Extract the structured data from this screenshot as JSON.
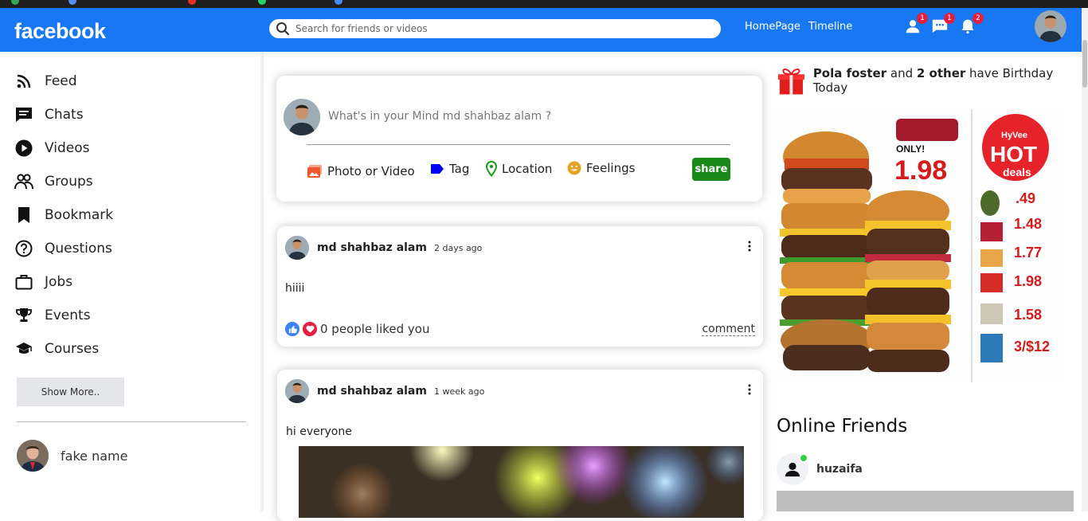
{
  "header": {
    "logo": "facebook",
    "search_placeholder": "Search for friends or videos",
    "links": [
      "HomePage",
      "Timeline"
    ],
    "notifications": [
      {
        "icon": "person-icon",
        "count": "1"
      },
      {
        "icon": "chat-icon",
        "count": "1"
      },
      {
        "icon": "bell-icon",
        "count": "2"
      }
    ]
  },
  "sidebar": {
    "items": [
      {
        "label": "Feed",
        "icon": "rss-icon"
      },
      {
        "label": "Chats",
        "icon": "chat-icon"
      },
      {
        "label": "Videos",
        "icon": "play-circle-icon"
      },
      {
        "label": "Groups",
        "icon": "group-icon"
      },
      {
        "label": "Bookmark",
        "icon": "bookmark-icon"
      },
      {
        "label": "Questions",
        "icon": "help-circle-icon"
      },
      {
        "label": "Jobs",
        "icon": "briefcase-icon"
      },
      {
        "label": "Events",
        "icon": "trophy-icon"
      },
      {
        "label": "Courses",
        "icon": "graduation-cap-icon"
      }
    ],
    "show_more": "Show More..",
    "friends": [
      {
        "name": "fake name"
      }
    ]
  },
  "share": {
    "prompt": "What's in your Mind md shahbaz alam ?",
    "options": [
      {
        "label": "Photo or Video",
        "icon": "photo-icon",
        "color": "#f3582c"
      },
      {
        "label": "Tag",
        "icon": "tag-icon",
        "color": "#0000ff"
      },
      {
        "label": "Location",
        "icon": "location-pin-icon",
        "color": "#1a9d1a"
      },
      {
        "label": "Feelings",
        "icon": "smiley-icon",
        "color": "#e3a325"
      }
    ],
    "button": "share"
  },
  "posts": [
    {
      "author": "md shahbaz alam",
      "time": "2 days ago",
      "text": "hiiii",
      "likes": "0 people liked you",
      "comment": "comment"
    },
    {
      "author": "md shahbaz alam",
      "time": "1 week ago",
      "text": "hi everyone"
    }
  ],
  "rightbar": {
    "birthday": {
      "name": "Pola foster",
      "middle": " and ",
      "others": "2 other",
      "suffix": " have Birthday Today"
    },
    "ad": {
      "only": "ONLY!",
      "price_main": "1.98",
      "brand_top": "HyVee",
      "brand_hot": "HOT",
      "brand_deals": "deals",
      "prices": [
        ".49",
        "1.48",
        "1.77",
        "1.98",
        "1.58",
        "3/$12"
      ]
    },
    "online_title": "Online Friends",
    "online": [
      {
        "name": "huzaifa"
      }
    ]
  },
  "colors": {
    "brand": "#1877f2",
    "share_button": "#198a1a",
    "badge": "#e41e3f",
    "online_dot": "#2fd13f"
  }
}
